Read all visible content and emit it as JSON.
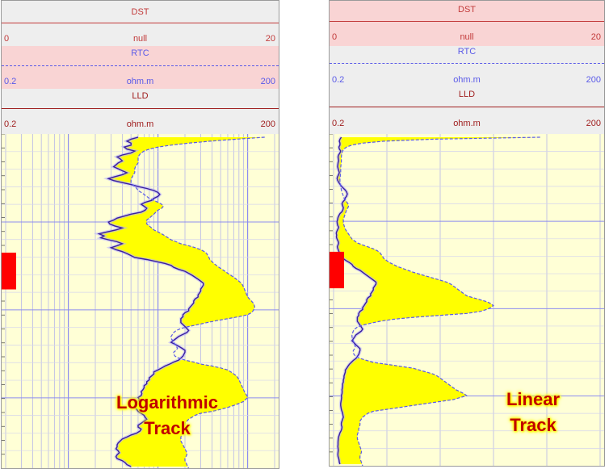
{
  "colors": {
    "track_bg": "#ffffd6",
    "dst": "#c23a3a",
    "rtc": "#5a5ae8",
    "lld": "#3a1f9e",
    "fill": "#ffff00",
    "marker": "#ff0000",
    "header_pink": "#f9d4d4",
    "header_gray": "#eeeeee"
  },
  "panels": [
    {
      "curves": {
        "dst": {
          "name": "DST",
          "min": "0",
          "unit": "null",
          "max": "20"
        },
        "rtc": {
          "name": "RTC",
          "min": "0.2",
          "unit": "ohm.m",
          "max": "200"
        },
        "lld": {
          "name": "LLD",
          "min": "0.2",
          "unit": "ohm.m",
          "max": "200"
        }
      },
      "scale": "log",
      "caption_line1": "Logarithmic",
      "caption_line2": "Track"
    },
    {
      "curves": {
        "dst": {
          "name": "DST",
          "min": "0",
          "unit": "null",
          "max": "20"
        },
        "rtc": {
          "name": "RTC",
          "min": "0.2",
          "unit": "ohm.m",
          "max": "200"
        },
        "lld": {
          "name": "LLD",
          "min": "0.2",
          "unit": "ohm.m",
          "max": "200"
        }
      },
      "scale": "linear",
      "caption_line1": "Linear",
      "caption_line2": "Track"
    }
  ],
  "chart_data": {
    "type": "line",
    "depth_axis": "relative depth (top to bottom), unlabeled",
    "lld_ohm_m": [
      6,
      5,
      4.5,
      5,
      5,
      4.2,
      4.5,
      5.5,
      5,
      4,
      3.5,
      3.8,
      4,
      3.6,
      3.4,
      3.2,
      3.6,
      4,
      4.5,
      4,
      3.3,
      2.8,
      3.2,
      4,
      5,
      6,
      7.5,
      9,
      10,
      10.5,
      10,
      9,
      8.5,
      7.2,
      6.5,
      7,
      7.5,
      7.2,
      6.5,
      5,
      4.2,
      3.5,
      3.2,
      2.8,
      2.9,
      3.3,
      4,
      3.4,
      2.7,
      2.2,
      2.5,
      2.3,
      2.8,
      3.5,
      4,
      3.5,
      3,
      3.4,
      4,
      4.5,
      5,
      5.5,
      7.5,
      9.5,
      12,
      14,
      15,
      17,
      20,
      22,
      24,
      26,
      28,
      30,
      32,
      32,
      31,
      30,
      30,
      29,
      28,
      28,
      26,
      25,
      25,
      24,
      23,
      22,
      22,
      20,
      19,
      19,
      18,
      18,
      18,
      19,
      20,
      21,
      22,
      21,
      19,
      17,
      16,
      15,
      14,
      15.5,
      17,
      18.5,
      20,
      20,
      19.5,
      19,
      18,
      17,
      15,
      13.5,
      12,
      11,
      10,
      9,
      9,
      8.5,
      8,
      8,
      7.5,
      7.5,
      7,
      7,
      6.8,
      6.5,
      6.6,
      6.5,
      6,
      6.2,
      6,
      5.8,
      5.5,
      5.5,
      5.8,
      6,
      6.5,
      7,
      7.2,
      7.5,
      7,
      6.5,
      6,
      6,
      6.5,
      6.3,
      5.8,
      5,
      4.5,
      4,
      3.8,
      3.6,
      3.5,
      3.5,
      3.4,
      3.6,
      3.7,
      3.5,
      3.4,
      3.5,
      4,
      4.3,
      4.5,
      5
    ],
    "rtc_ohm_m": [
      155,
      75,
      38,
      22,
      14,
      10,
      8,
      7,
      6.5,
      6.2,
      6,
      6,
      6,
      6,
      5.8,
      5.6,
      5.5,
      5.5,
      5.5,
      5.3,
      5.2,
      5,
      5,
      5,
      5.2,
      5.5,
      5.8,
      6,
      6.5,
      7,
      7.5,
      8,
      9,
      10,
      11,
      11.5,
      11,
      10,
      9.5,
      9,
      8.5,
      8,
      7.5,
      7.5,
      7.5,
      8,
      8.5,
      9,
      10,
      11,
      12,
      13,
      14,
      16,
      18,
      22,
      26,
      30,
      33,
      35,
      36,
      37,
      38,
      40,
      42,
      45,
      48,
      52,
      56,
      60,
      65,
      70,
      75,
      80,
      85,
      88,
      90,
      92,
      94,
      96,
      98,
      100,
      105,
      110,
      115,
      118,
      120,
      118,
      115,
      110,
      100,
      80,
      60,
      45,
      35,
      28,
      22,
      18,
      16,
      15,
      14.5,
      14,
      14,
      14.5,
      15,
      15.5,
      16,
      16.5,
      16,
      15,
      15,
      15.5,
      17,
      20,
      25,
      30,
      40,
      50,
      60,
      65,
      70,
      75,
      78,
      80,
      82,
      84,
      86,
      88,
      90,
      92,
      95,
      98,
      100,
      95,
      90,
      80,
      70,
      60,
      50,
      40,
      30,
      26,
      24,
      22,
      21,
      20,
      20,
      20,
      19.5,
      19,
      19,
      18.5,
      18,
      18,
      18,
      18.5,
      19,
      19.5,
      20,
      20.5,
      21,
      21,
      20.5,
      20,
      20,
      20.5,
      21,
      21.5,
      22,
      22,
      22
    ],
    "dst_null": [
      0,
      0,
      0,
      0,
      0,
      0,
      0,
      0,
      0,
      0
    ],
    "marker_interval_relative": [
      0.355,
      0.465
    ],
    "note": "Same data displayed on a logarithmic and a linear track"
  }
}
